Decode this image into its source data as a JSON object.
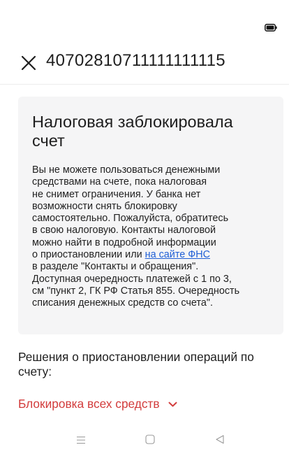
{
  "header": {
    "account_number": "40702810711111111115"
  },
  "notice": {
    "title_line1": "Налоговая заблокировала",
    "title_line2": "счет",
    "body_lines": [
      "Вы не можете пользоваться денежными",
      "средствами на счете, пока налоговая",
      "не снимет ограничения. У банка нет",
      "возможности снять блокировку",
      "самостоятельно. Пожалуйста, обратитесь",
      "в свою налоговую. Контакты налоговой",
      "можно найти в подробной информации"
    ],
    "link_prefix": "о приостановлении или ",
    "link_text": "на сайте ФНС",
    "body_lines_after": [
      "в разделе \"Контакты и обращения\".",
      "Доступная очередность платежей с 1 по 3,",
      "см \"пункт 2, ГК РФ Статья 855. Очередность",
      "списания денежных средств со счета\"."
    ]
  },
  "decisions": {
    "heading_line1": "Решения о приостановлении операций по",
    "heading_line2": "счету:",
    "dropdown_label": "Блокировка всех средств"
  },
  "icons": {
    "close": "close-icon",
    "battery": "battery-icon",
    "chevron": "chevron-down-icon",
    "nav_menu": "menu-icon",
    "nav_home": "home-icon",
    "nav_back": "back-icon"
  },
  "colors": {
    "link": "#1f5fd6",
    "dropdown": "#d23c3c",
    "card_background": "#f5f5f6"
  }
}
